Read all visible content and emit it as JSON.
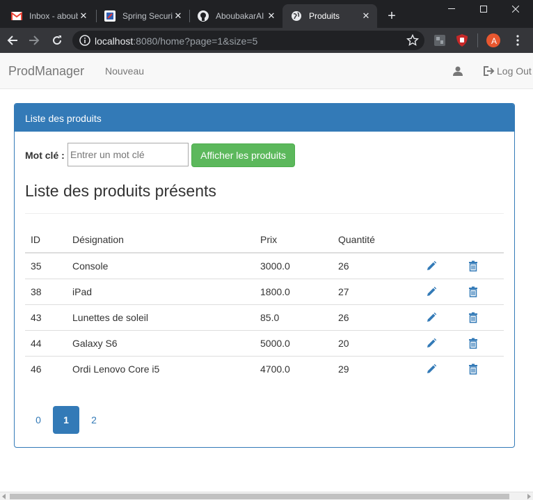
{
  "browser": {
    "tabs": [
      {
        "title": "Inbox - aboubakar",
        "icon": "gmail-icon",
        "active": false
      },
      {
        "title": "Spring Security",
        "icon": "spring-security-icon",
        "active": false
      },
      {
        "title": "AboubakarAI",
        "icon": "github-icon",
        "active": false
      },
      {
        "title": "Produits",
        "icon": "globe-icon",
        "active": true
      }
    ],
    "url_host": "localhost",
    "url_path": ":8080/home?page=1&size=5",
    "profile_initial": "A",
    "colors": {
      "tabstrip": "#202124",
      "toolbar": "#35363a",
      "profile": "#e8572f"
    }
  },
  "navbar": {
    "brand": "ProdManager",
    "new_link": "Nouveau",
    "logout_link": "Log Out"
  },
  "panel": {
    "heading": "Liste des produits",
    "keyword_label": "Mot clé :",
    "keyword_value": "",
    "keyword_placeholder": "Entrer un mot clé",
    "search_button": "Afficher les produits",
    "section_title": "Liste des produits présents",
    "colors": {
      "primary": "#337ab7",
      "success": "#5cb85c"
    }
  },
  "table": {
    "headers": {
      "id": "ID",
      "designation": "Désignation",
      "prix": "Prix",
      "quantite": "Quantité"
    },
    "rows": [
      {
        "id": "35",
        "designation": "Console",
        "prix": "3000.0",
        "quantite": "26"
      },
      {
        "id": "38",
        "designation": "iPad",
        "prix": "1800.0",
        "quantite": "27"
      },
      {
        "id": "43",
        "designation": "Lunettes de soleil",
        "prix": "85.0",
        "quantite": "26"
      },
      {
        "id": "44",
        "designation": "Galaxy S6",
        "prix": "5000.0",
        "quantite": "20"
      },
      {
        "id": "46",
        "designation": "Ordi Lenovo Core i5",
        "prix": "4700.0",
        "quantite": "29"
      }
    ]
  },
  "pagination": {
    "pages": [
      "0",
      "1",
      "2"
    ],
    "active": "1"
  }
}
